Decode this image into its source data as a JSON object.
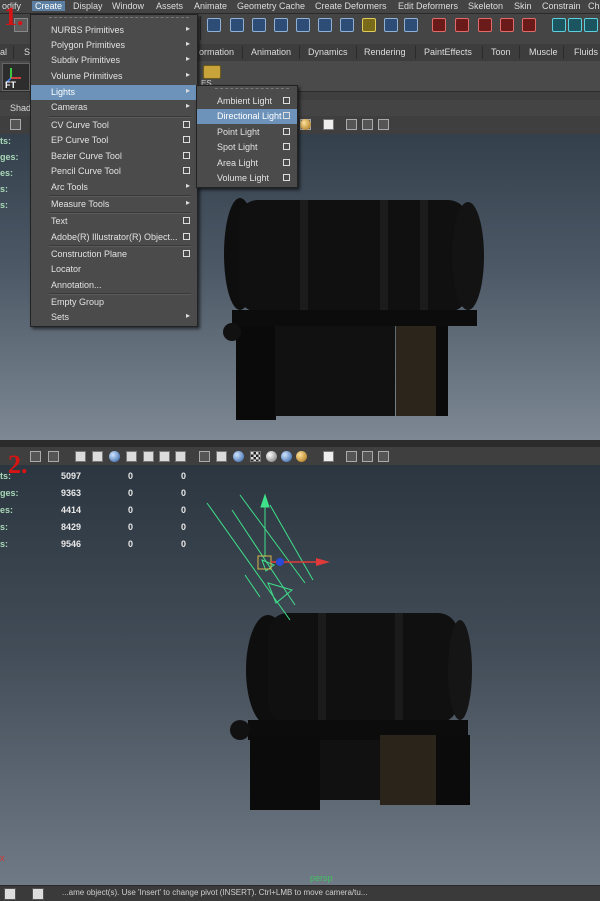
{
  "step_labels": {
    "step1": "1.",
    "step2": "2."
  },
  "menubar": {
    "items": [
      "odify",
      "Create",
      "Display",
      "Window",
      "Assets",
      "Animate",
      "Geometry Cache",
      "Create Deformers",
      "Edit Deformers",
      "Skeleton",
      "Skin",
      "Constrain",
      "Ch"
    ]
  },
  "shelf_tabs": [
    "al",
    "S",
    "ormation",
    "Animation",
    "Dynamics",
    "Rendering",
    "PaintEffects",
    "Toon",
    "Muscle",
    "Fluids"
  ],
  "shelf": {
    "left_label": "FT",
    "right_label": "ES"
  },
  "viewport_menu": {
    "shading_label": "Shad"
  },
  "hud_labels_panel1": [
    "ts:",
    "ges:",
    "es:",
    "s:",
    "s:"
  ],
  "create_menu": {
    "items": [
      {
        "label": "NURBS Primitives",
        "kind": "submenu"
      },
      {
        "label": "Polygon Primitives",
        "kind": "submenu"
      },
      {
        "label": "Subdiv Primitives",
        "kind": "submenu"
      },
      {
        "label": "Volume Primitives",
        "kind": "submenu"
      },
      {
        "label": "Lights",
        "kind": "submenu",
        "highlighted": true
      },
      {
        "label": "Cameras",
        "kind": "submenu"
      },
      {
        "label": "CV Curve Tool",
        "kind": "option"
      },
      {
        "label": "EP Curve Tool",
        "kind": "option"
      },
      {
        "label": "Bezier Curve Tool",
        "kind": "option"
      },
      {
        "label": "Pencil Curve Tool",
        "kind": "option"
      },
      {
        "label": "Arc Tools",
        "kind": "submenu"
      },
      {
        "label": "Measure Tools",
        "kind": "submenu"
      },
      {
        "label": "Text",
        "kind": "option"
      },
      {
        "label": "Adobe(R) Illustrator(R) Object...",
        "kind": "option"
      },
      {
        "label": "Construction Plane",
        "kind": "option"
      },
      {
        "label": "Locator",
        "kind": "none"
      },
      {
        "label": "Annotation...",
        "kind": "none"
      },
      {
        "label": "Empty Group",
        "kind": "none"
      },
      {
        "label": "Sets",
        "kind": "submenu"
      }
    ]
  },
  "lights_submenu": {
    "items": [
      {
        "label": "Ambient Light"
      },
      {
        "label": "Directional Light",
        "highlighted": true
      },
      {
        "label": "Point Light"
      },
      {
        "label": "Spot Light"
      },
      {
        "label": "Area Light"
      },
      {
        "label": "Volume Light"
      }
    ]
  },
  "hud_panel2": {
    "labels": [
      "ts:",
      "ges:",
      "es:",
      "s:",
      "s:"
    ],
    "values": [
      [
        "5097",
        "0",
        "0"
      ],
      [
        "9363",
        "0",
        "0"
      ],
      [
        "4414",
        "0",
        "0"
      ],
      [
        "8429",
        "0",
        "0"
      ],
      [
        "9546",
        "0",
        "0"
      ]
    ]
  },
  "viewport2": {
    "camera_label": "persp"
  },
  "command_line": {
    "text": "...ame object(s). Use 'Insert' to change pivot (INSERT). Ctrl+LMB to move camera/tu..."
  },
  "colors": {
    "highlight": "#6d93ba",
    "step_red": "#d61414",
    "hud_green": "#a9d8b8",
    "light_manip": "#3fe08a"
  }
}
